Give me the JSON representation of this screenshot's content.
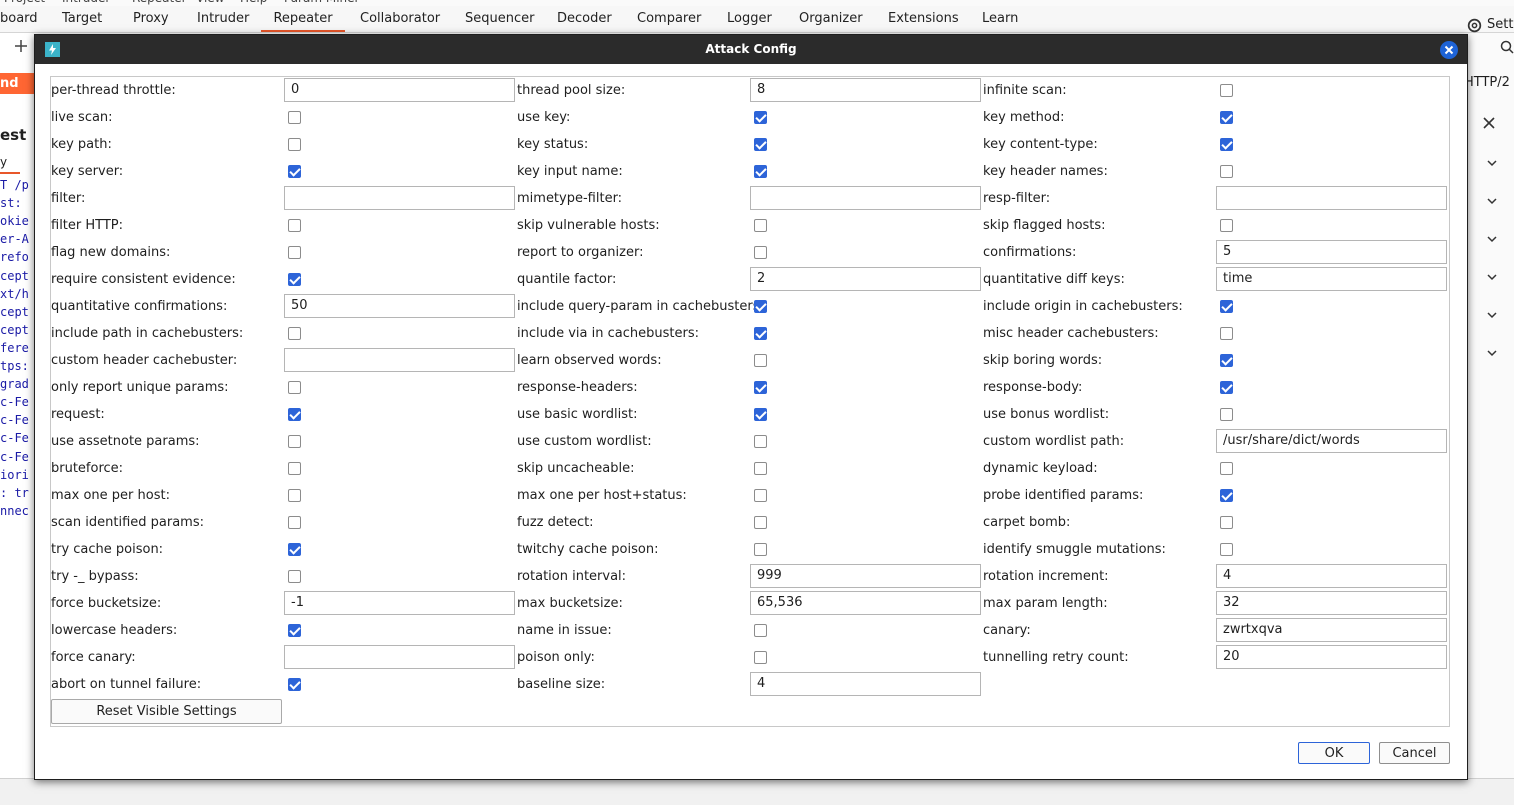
{
  "menu": [
    "Project",
    "Intruder",
    "Repeater",
    "View",
    "Help",
    "Param Miner"
  ],
  "tabs": [
    "board",
    "Target",
    "Proxy",
    "Intruder",
    "Repeater",
    "Collaborator",
    "Sequencer",
    "Decoder",
    "Comparer",
    "Logger",
    "Organizer",
    "Extensions",
    "Learn"
  ],
  "active_tab": "Repeater",
  "settings_label": "Setti",
  "background": {
    "send_label": "nd",
    "request_label": "est",
    "http_label": "HTTP/2",
    "code_lines": [
      "T /p",
      "st: ",
      "okie",
      "er-A",
      "refo",
      "cept",
      "xt/h",
      "cept",
      "cept",
      "fere",
      "tps:",
      "grad",
      "c-Fe",
      "c-Fe",
      "c-Fe",
      "c-Fe",
      "iori",
      ": tr",
      "nnec"
    ]
  },
  "dialog": {
    "title": "Attack Config",
    "reset_label": "Reset Visible Settings",
    "ok_label": "OK",
    "cancel_label": "Cancel",
    "rows": [
      [
        {
          "label": "per-thread throttle:",
          "type": "text",
          "value": "0"
        },
        {
          "label": "thread pool size:",
          "type": "text",
          "value": "8"
        },
        {
          "label": "infinite scan:",
          "type": "check",
          "checked": false
        }
      ],
      [
        {
          "label": "live scan:",
          "type": "check",
          "checked": false
        },
        {
          "label": "use key:",
          "type": "check",
          "checked": true
        },
        {
          "label": "key method:",
          "type": "check",
          "checked": true
        }
      ],
      [
        {
          "label": "key path:",
          "type": "check",
          "checked": false
        },
        {
          "label": "key status:",
          "type": "check",
          "checked": true
        },
        {
          "label": "key content-type:",
          "type": "check",
          "checked": true
        }
      ],
      [
        {
          "label": "key server:",
          "type": "check",
          "checked": true
        },
        {
          "label": "key input name:",
          "type": "check",
          "checked": true
        },
        {
          "label": "key header names:",
          "type": "check",
          "checked": false
        }
      ],
      [
        {
          "label": "filter:",
          "type": "text",
          "value": ""
        },
        {
          "label": "mimetype-filter:",
          "type": "text",
          "value": ""
        },
        {
          "label": "resp-filter:",
          "type": "text",
          "value": ""
        }
      ],
      [
        {
          "label": "filter HTTP:",
          "type": "check",
          "checked": false
        },
        {
          "label": "skip vulnerable hosts:",
          "type": "check",
          "checked": false
        },
        {
          "label": "skip flagged hosts:",
          "type": "check",
          "checked": false
        }
      ],
      [
        {
          "label": "flag new domains:",
          "type": "check",
          "checked": false
        },
        {
          "label": "report to organizer:",
          "type": "check",
          "checked": false
        },
        {
          "label": "confirmations:",
          "type": "text",
          "value": "5"
        }
      ],
      [
        {
          "label": "require consistent evidence:",
          "type": "check",
          "checked": true
        },
        {
          "label": "quantile factor:",
          "type": "text",
          "value": "2"
        },
        {
          "label": "quantitative diff keys:",
          "type": "text",
          "value": "time"
        }
      ],
      [
        {
          "label": "quantitative confirmations:",
          "type": "text",
          "value": "50"
        },
        {
          "label": "include query-param in cachebusters:",
          "type": "check",
          "checked": true
        },
        {
          "label": "include origin in cachebusters:",
          "type": "check",
          "checked": true
        }
      ],
      [
        {
          "label": "include path in cachebusters:",
          "type": "check",
          "checked": false
        },
        {
          "label": "include via in cachebusters:",
          "type": "check",
          "checked": true
        },
        {
          "label": "misc header cachebusters:",
          "type": "check",
          "checked": false
        }
      ],
      [
        {
          "label": "custom header cachebuster:",
          "type": "text",
          "value": ""
        },
        {
          "label": "learn observed words:",
          "type": "check",
          "checked": false
        },
        {
          "label": "skip boring words:",
          "type": "check",
          "checked": true
        }
      ],
      [
        {
          "label": "only report unique params:",
          "type": "check",
          "checked": false
        },
        {
          "label": "response-headers:",
          "type": "check",
          "checked": true
        },
        {
          "label": "response-body:",
          "type": "check",
          "checked": true
        }
      ],
      [
        {
          "label": "request:",
          "type": "check",
          "checked": true
        },
        {
          "label": "use basic wordlist:",
          "type": "check",
          "checked": true
        },
        {
          "label": "use bonus wordlist:",
          "type": "check",
          "checked": false
        }
      ],
      [
        {
          "label": "use assetnote params:",
          "type": "check",
          "checked": false
        },
        {
          "label": "use custom wordlist:",
          "type": "check",
          "checked": false
        },
        {
          "label": "custom wordlist path:",
          "type": "text",
          "value": "/usr/share/dict/words"
        }
      ],
      [
        {
          "label": "bruteforce:",
          "type": "check",
          "checked": false
        },
        {
          "label": "skip uncacheable:",
          "type": "check",
          "checked": false
        },
        {
          "label": "dynamic keyload:",
          "type": "check",
          "checked": false
        }
      ],
      [
        {
          "label": "max one per host:",
          "type": "check",
          "checked": false
        },
        {
          "label": "max one per host+status:",
          "type": "check",
          "checked": false
        },
        {
          "label": "probe identified params:",
          "type": "check",
          "checked": true
        }
      ],
      [
        {
          "label": "scan identified params:",
          "type": "check",
          "checked": false
        },
        {
          "label": "fuzz detect:",
          "type": "check",
          "checked": false
        },
        {
          "label": "carpet bomb:",
          "type": "check",
          "checked": false
        }
      ],
      [
        {
          "label": "try cache poison:",
          "type": "check",
          "checked": true
        },
        {
          "label": "twitchy cache poison:",
          "type": "check",
          "checked": false
        },
        {
          "label": "identify smuggle mutations:",
          "type": "check",
          "checked": false
        }
      ],
      [
        {
          "label": "try -_ bypass:",
          "type": "check",
          "checked": false
        },
        {
          "label": "rotation interval:",
          "type": "text",
          "value": "999"
        },
        {
          "label": "rotation increment:",
          "type": "text",
          "value": "4"
        }
      ],
      [
        {
          "label": "force bucketsize:",
          "type": "text",
          "value": "-1"
        },
        {
          "label": "max bucketsize:",
          "type": "text",
          "value": "65,536"
        },
        {
          "label": "max param length:",
          "type": "text",
          "value": "32"
        }
      ],
      [
        {
          "label": "lowercase headers:",
          "type": "check",
          "checked": true
        },
        {
          "label": "name in issue:",
          "type": "check",
          "checked": false
        },
        {
          "label": "canary:",
          "type": "text",
          "value": "zwrtxqva"
        }
      ],
      [
        {
          "label": "force canary:",
          "type": "text",
          "value": ""
        },
        {
          "label": "poison only:",
          "type": "check",
          "checked": false
        },
        {
          "label": "tunnelling retry count:",
          "type": "text",
          "value": "20"
        }
      ],
      [
        {
          "label": "abort on tunnel failure:",
          "type": "check",
          "checked": true
        },
        {
          "label": "baseline size:",
          "type": "text",
          "value": "4"
        }
      ]
    ]
  },
  "colors": {
    "accent": "#e8572a",
    "check": "#2d64d8",
    "titlebar": "#2b2b2b",
    "close": "#1e63d6",
    "app_icon": "#3bb3c9"
  },
  "icons": [
    "gear-icon",
    "plus-icon",
    "search-icon",
    "close-icon",
    "chevron-down-icon",
    "lightning-icon"
  ]
}
